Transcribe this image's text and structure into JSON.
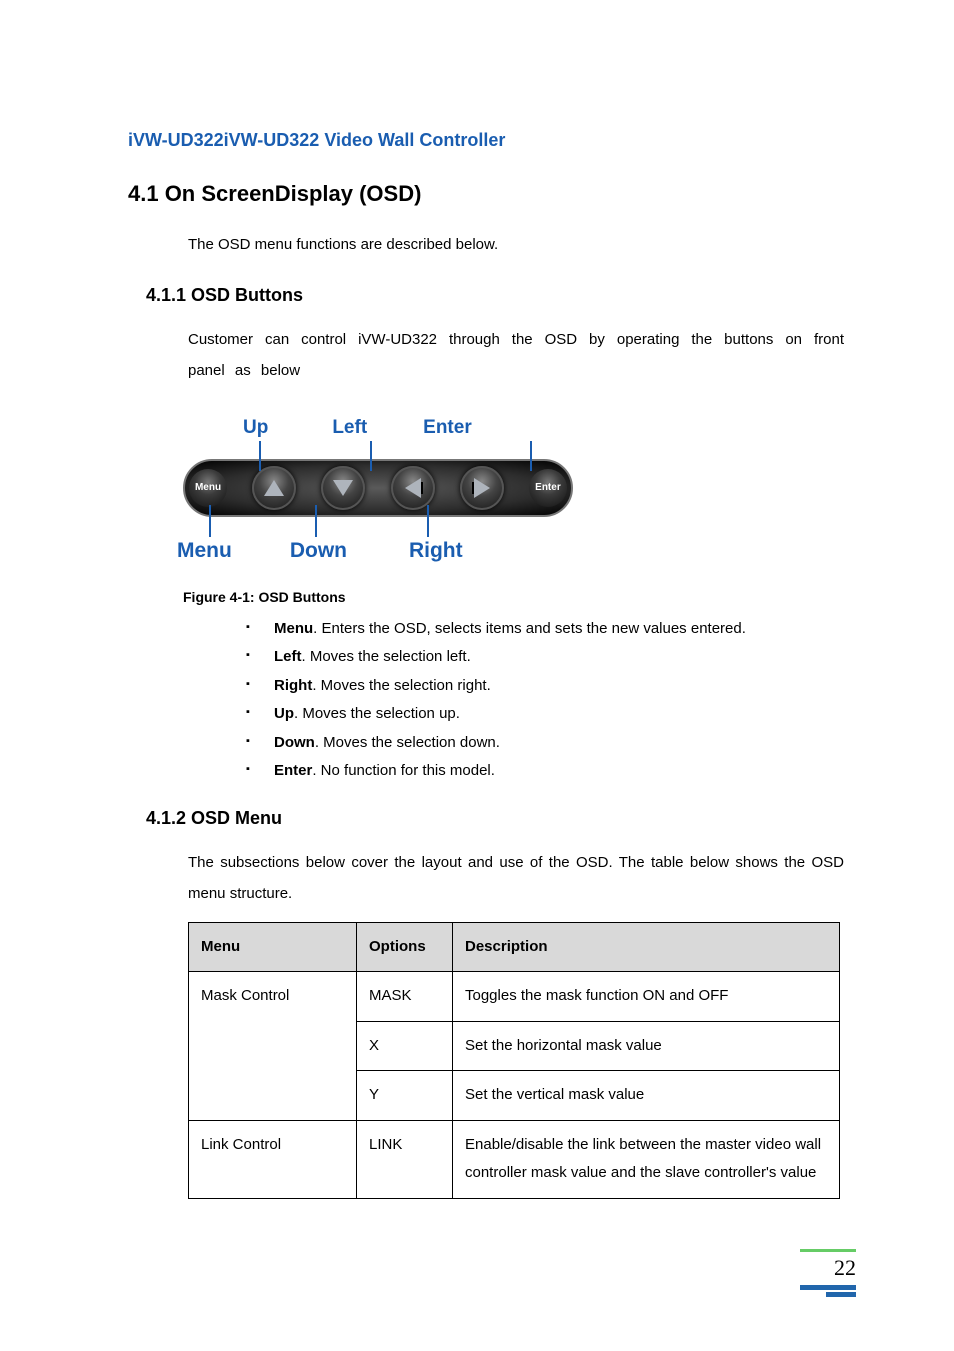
{
  "header": {
    "product_line": "iVW-UD322iVW-UD322 Video Wall Controller"
  },
  "section": {
    "title": "4.1 On ScreenDisplay (OSD)",
    "intro": "The OSD menu functions are described below."
  },
  "sub1": {
    "title": "4.1.1 OSD Buttons",
    "body": "Customer can control iVW-UD322 through the OSD by operating the buttons on front panel as below",
    "figure_caption": "Figure 4-1: OSD Buttons",
    "panel_labels": {
      "up": "Up",
      "left": "Left",
      "enter": "Enter",
      "menu": "Menu",
      "down": "Down",
      "right": "Right",
      "end_left": "Menu",
      "end_right": "Enter"
    },
    "bullets": [
      {
        "term": "Menu",
        "desc": ". Enters the OSD, selects items and sets the new values entered."
      },
      {
        "term": "Left",
        "desc": ". Moves the selection left."
      },
      {
        "term": "Right",
        "desc": ". Moves the selection right."
      },
      {
        "term": "Up",
        "desc": ". Moves the selection up."
      },
      {
        "term": "Down",
        "desc": ". Moves the selection down."
      },
      {
        "term": "Enter",
        "desc": ". No function for this model."
      }
    ]
  },
  "sub2": {
    "title": "4.1.2 OSD Menu",
    "body": "The subsections below cover the layout and use of the OSD. The table below shows the OSD menu structure.",
    "table": {
      "headers": {
        "menu": "Menu",
        "options": "Options",
        "description": "Description"
      },
      "rows": [
        {
          "menu": "Mask Control",
          "option": "MASK",
          "desc": "Toggles the mask function ON and OFF"
        },
        {
          "menu": "",
          "option": "X",
          "desc": "Set the horizontal mask value"
        },
        {
          "menu": "",
          "option": "Y",
          "desc": "Set the vertical mask value"
        },
        {
          "menu": "Link Control",
          "option": "LINK",
          "desc": "Enable/disable the link between the master video wall controller mask value and the slave controller's value"
        }
      ]
    }
  },
  "page_number": "22"
}
